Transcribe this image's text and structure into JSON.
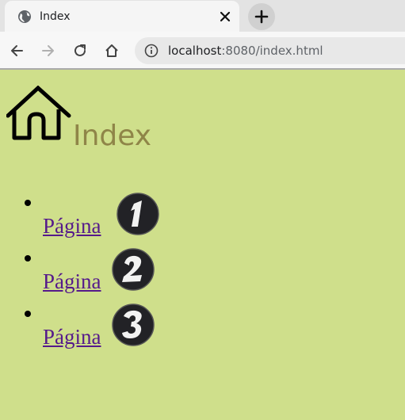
{
  "browser": {
    "tab_title": "Index",
    "url_host": "localhost",
    "url_rest": ":8080/index.html"
  },
  "page": {
    "title": "Index",
    "logo_icon": "home-icon",
    "links": [
      {
        "label": "Página ",
        "badge": "1"
      },
      {
        "label": "Página",
        "badge": "2"
      },
      {
        "label": "Página",
        "badge": "3"
      }
    ]
  },
  "colors": {
    "background": "#cfdf8b",
    "title": "#8f8548",
    "link": "#551a8b"
  }
}
